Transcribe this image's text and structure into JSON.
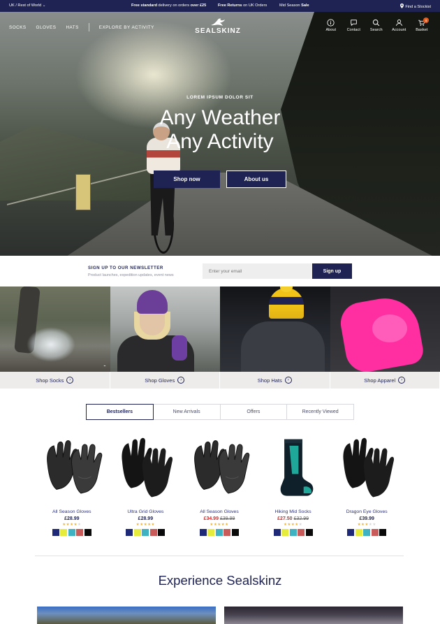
{
  "topbar": {
    "region": "UK / Rest of World ⌄",
    "msg1_bold": "Free standard",
    "msg1_rest": " delivery on orders ",
    "msg1_bold2": "over £25",
    "msg2_bold": "Free Returns",
    "msg2_rest": " on UK Orders",
    "msg3_rest": "Mid Season ",
    "msg3_bold": "Sale",
    "stockist": "Find a Stockist"
  },
  "nav": {
    "links": [
      "SOCKS",
      "GLOVES",
      "HATS"
    ],
    "explore": "EXPLORE BY ACTIVITY",
    "logo_text": "SEALSKINZ",
    "icons": [
      {
        "label": "About",
        "icon": "info-icon"
      },
      {
        "label": "Contact",
        "icon": "chat-icon"
      },
      {
        "label": "Search",
        "icon": "search-icon"
      },
      {
        "label": "Account",
        "icon": "user-icon"
      },
      {
        "label": "Basket",
        "icon": "basket-icon"
      }
    ],
    "basket_count": "0"
  },
  "hero": {
    "eyebrow": "LOREM IPSUM DOLOR SIT",
    "line1": "Any Weather",
    "line2": "Any Activity",
    "primary_cta": "Shop now",
    "secondary_cta": "About us"
  },
  "newsletter": {
    "title": "SIGN UP TO OUR NEWSLETTER",
    "subtitle": "Product launches, expedition updates, event news",
    "placeholder": "Enter your email",
    "button": "Sign up"
  },
  "categories": [
    {
      "label": "Shop Socks"
    },
    {
      "label": "Shop Gloves"
    },
    {
      "label": "Shop Hats"
    },
    {
      "label": "Shop Apparel"
    }
  ],
  "tabs": [
    {
      "label": "Bestsellers",
      "active": true
    },
    {
      "label": "New Arrivals",
      "active": false
    },
    {
      "label": "Offers",
      "active": false
    },
    {
      "label": "Recently Viewed",
      "active": false
    }
  ],
  "products": [
    {
      "name": "All Season Gloves",
      "price": "£28.99",
      "sale_price": "",
      "was_price": "",
      "rating": 4,
      "type": "leather-glove"
    },
    {
      "name": "Ultra Grid Gloves",
      "price": "£28.99",
      "sale_price": "",
      "was_price": "",
      "rating": 5,
      "type": "knit-glove"
    },
    {
      "name": "All Season Gloves",
      "price": "",
      "sale_price": "£34.99",
      "was_price": "£39.99",
      "rating": 5,
      "type": "leather-glove"
    },
    {
      "name": "Hiking Mid Socks",
      "price": "",
      "sale_price": "£27.50",
      "was_price": "£32.99",
      "rating": 4,
      "type": "sock"
    },
    {
      "name": "Dragon Eye Gloves",
      "price": "£39.99",
      "sale_price": "",
      "was_price": "",
      "rating": 3,
      "type": "knit-glove"
    }
  ],
  "swatch_colors": [
    "#1e2a78",
    "#e5ec3c",
    "#3fb2c2",
    "#c95a5a",
    "#0a0a0a"
  ],
  "section_title": "Experience Sealskinz",
  "colors": {
    "navy": "#1e2353",
    "sale_red": "#d12a2a",
    "star_gold": "#f3b22a",
    "badge_orange": "#e85b1b"
  }
}
